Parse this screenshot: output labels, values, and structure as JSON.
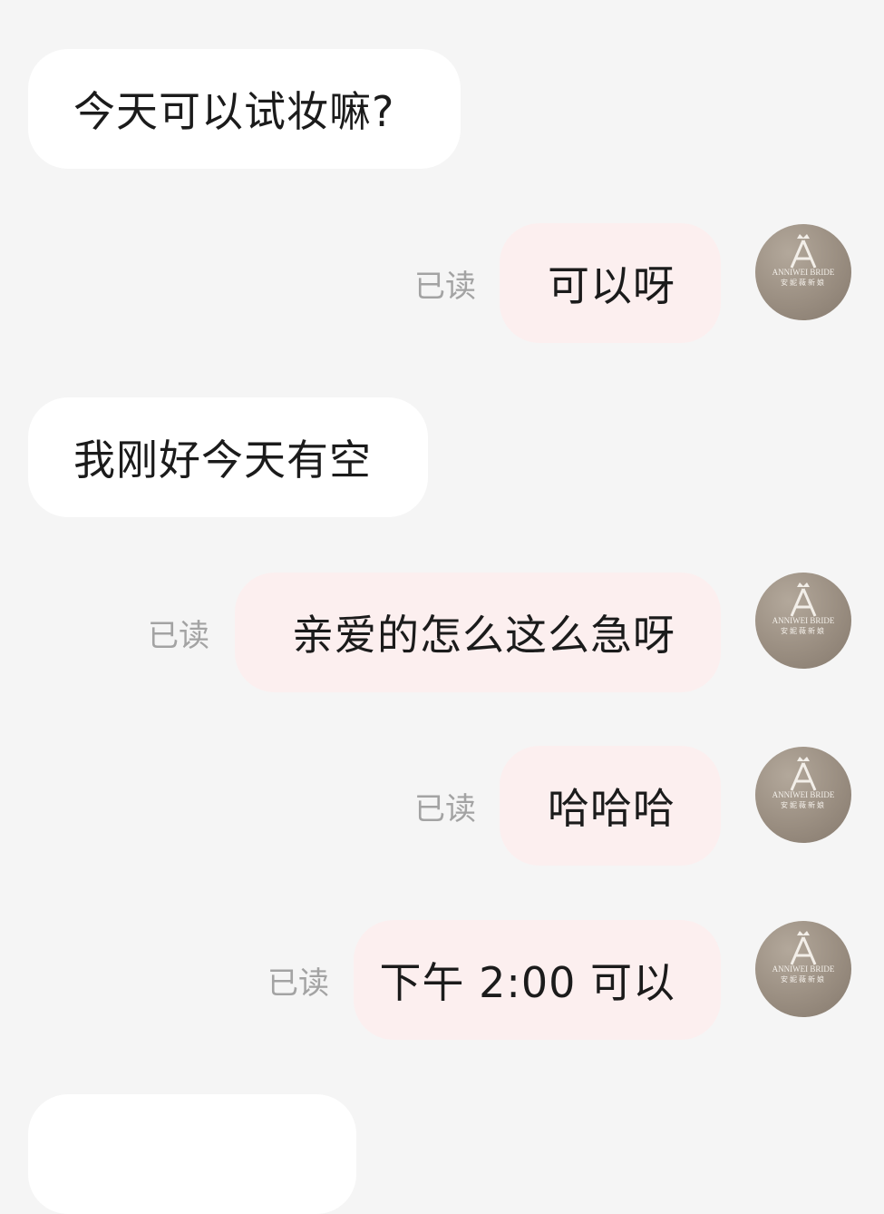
{
  "messages": [
    {
      "side": "in",
      "text": "今天可以试妆嘛?"
    },
    {
      "side": "out",
      "text": "可以呀",
      "status": "已读"
    },
    {
      "side": "in",
      "text": "我刚好今天有空"
    },
    {
      "side": "out",
      "text": "亲爱的怎么这么急呀",
      "status": "已读"
    },
    {
      "side": "out",
      "text": "哈哈哈",
      "status": "已读"
    },
    {
      "side": "out",
      "text": "下午 2:00 可以",
      "status": "已读"
    }
  ],
  "avatar": {
    "brand_en": "ANNIWEI BRIDE",
    "brand_cn": "安妮薇新娘",
    "monogram": "A",
    "icon": "brand-logo-avatar"
  },
  "colors": {
    "background": "#f5f5f5",
    "incoming_bubble": "#ffffff",
    "outgoing_bubble": "#fcefef",
    "read_status": "#a3a3a3",
    "text": "#1b1b1b"
  }
}
